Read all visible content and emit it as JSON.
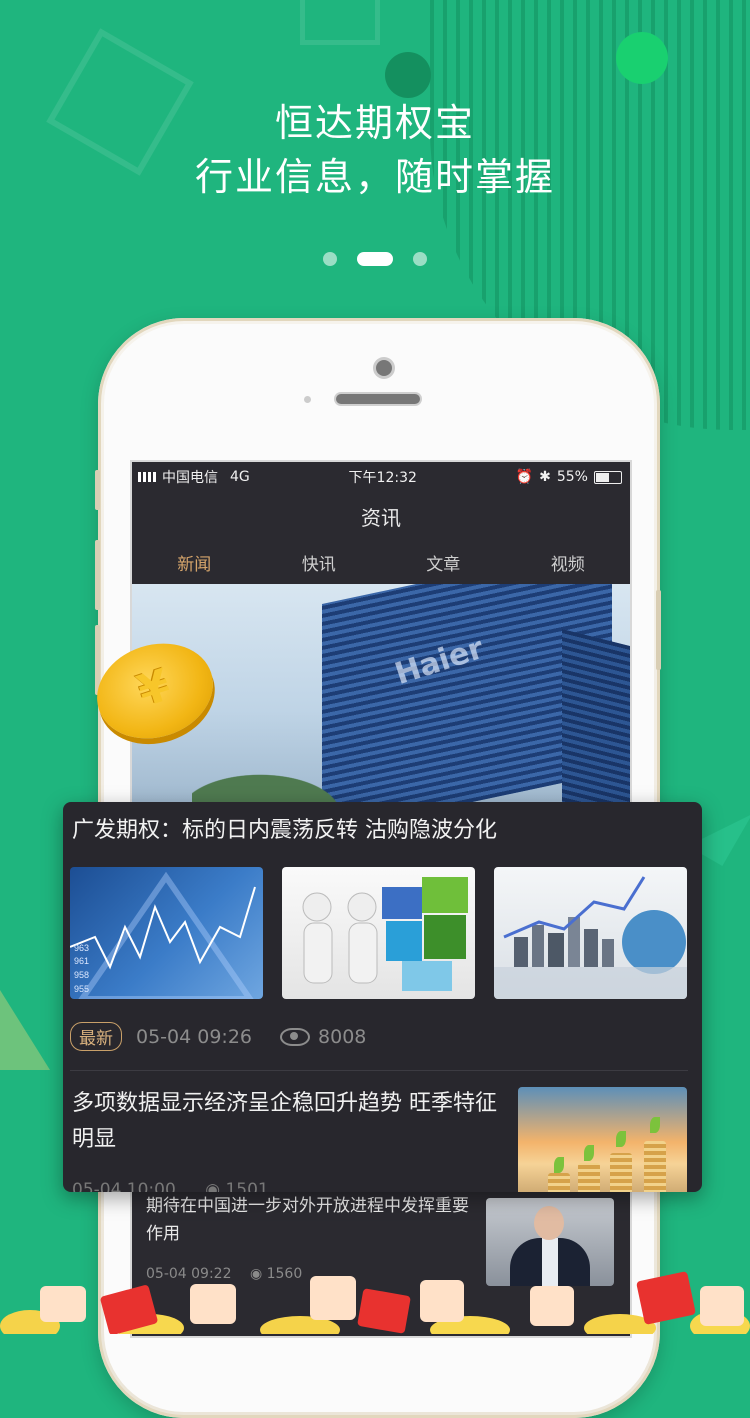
{
  "promo": {
    "title": "恒达期权宝",
    "subtitle": "行业信息，随时掌握",
    "page_indicator": {
      "count": 3,
      "active": 1
    }
  },
  "colors": {
    "background": "#1fb57e",
    "screen_bg": "#2b2a30",
    "card_bg": "#28272d",
    "accent_gold": "#d6a56b"
  },
  "phone_screen": {
    "status": {
      "carrier": "中国电信",
      "network": "4G",
      "time": "下午12:32",
      "battery": "55%"
    },
    "header_title": "资讯",
    "tabs": [
      {
        "label": "新闻",
        "active": true
      },
      {
        "label": "快讯",
        "active": false
      },
      {
        "label": "文章",
        "active": false
      },
      {
        "label": "视频",
        "active": false
      }
    ],
    "hero_text": "Haier",
    "item": {
      "title": "期待在中国进一步对外开放进程中发挥重要作用",
      "date": "05-04 09:22",
      "views": "1560",
      "thumb_icon": "man-in-suit-photo"
    }
  },
  "card": {
    "headline": "广发期权：标的日内震荡反转 沽购隐波分化",
    "images": [
      "stock-chart-photo",
      "puzzle-handshake-photo",
      "city-growth-chart-photo"
    ],
    "badge": "最新",
    "date": "05-04 09:26",
    "views": "8008",
    "second_headline": "多项数据显示经济呈企稳回升趋势 旺季特征明显",
    "second_meta": "05-04 10:00",
    "second_views": "1501",
    "second_thumb": "coin-stack-sprout-photo"
  },
  "decor": {
    "coin_symbol": "¥"
  }
}
